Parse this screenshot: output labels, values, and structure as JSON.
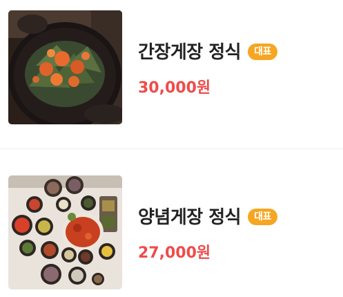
{
  "menu": {
    "items": [
      {
        "name": "간장게장 정식",
        "badge": "대표",
        "price": "30,000원",
        "image": "soy-marinated-crab-photo"
      },
      {
        "name": "양념게장 정식",
        "badge": "대표",
        "price": "27,000원",
        "image": "spicy-marinated-crab-set-photo"
      }
    ]
  },
  "colors": {
    "badge": "#f5a623",
    "price": "#ef4b4b",
    "name": "#222222",
    "divider": "#eeeeee"
  }
}
